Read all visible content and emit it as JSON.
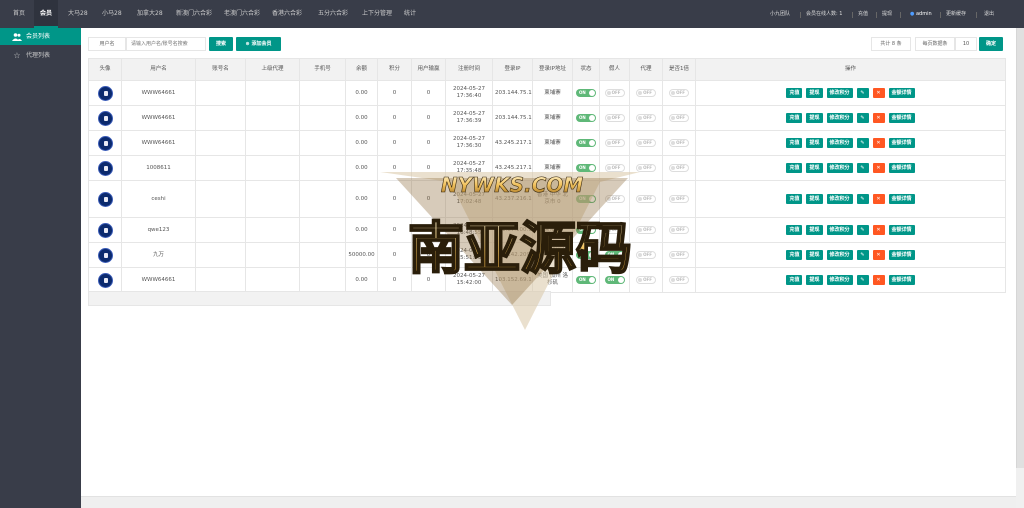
{
  "topnav": {
    "items": [
      "首页",
      "会员",
      "大马28",
      "小马28",
      "加拿大28",
      "新澳门六合彩",
      "老澳门六合彩",
      "香港六合彩",
      "五分六合彩",
      "上下分管理",
      "统计"
    ],
    "active": "会员",
    "right": {
      "promo": "小九团队",
      "online": "会员在线人数: 1",
      "recharge": "充值",
      "withdraw": "提现",
      "user": "admin",
      "password": "更新缓存",
      "logout": "退出"
    }
  },
  "sidebar": {
    "items": [
      {
        "label": "会员列表",
        "icon": "users-icon",
        "active": true
      },
      {
        "label": "代理列表",
        "icon": "star-icon",
        "active": false
      }
    ]
  },
  "toolbar": {
    "username_label": "用户名",
    "search_placeholder": "请输入用户名/账号名搜索",
    "search_button": "搜索",
    "add_button": "添加会员",
    "total_text": "共计 8 条",
    "per_page_label": "每页数据条",
    "per_page_value": "10",
    "confirm_button": "确定"
  },
  "table": {
    "columns": [
      "头像",
      "用户名",
      "账号名",
      "上级代理",
      "手机号",
      "余额",
      "积分",
      "用户输赢",
      "注册时间",
      "登录IP",
      "登录IP地址",
      "状态",
      "假人",
      "代理",
      "是否1倍",
      "操作"
    ],
    "actions": [
      "充值",
      "提现",
      "修改积分",
      "修改",
      "删除",
      "金额详情"
    ],
    "rows": [
      {
        "username": "WWW64661",
        "balance": "0.00",
        "points": "0",
        "winloss": "0",
        "reg_date": "2024-05-27",
        "reg_time": "17:36:40",
        "ip": "203.144.75.189",
        "location": "柬埔寨",
        "status": "ON",
        "fake": "OFF",
        "agent": "OFF",
        "single": "OFF"
      },
      {
        "username": "WWW64661",
        "balance": "0.00",
        "points": "0",
        "winloss": "0",
        "reg_date": "2024-05-27",
        "reg_time": "17:36:39",
        "ip": "203.144.75.189",
        "location": "柬埔寨",
        "status": "ON",
        "fake": "OFF",
        "agent": "OFF",
        "single": "OFF"
      },
      {
        "username": "WWW64661",
        "balance": "0.00",
        "points": "0",
        "winloss": "0",
        "reg_date": "2024-05-27",
        "reg_time": "17:36:30",
        "ip": "43.245.217.174",
        "location": "柬埔寨",
        "status": "ON",
        "fake": "OFF",
        "agent": "OFF",
        "single": "OFF"
      },
      {
        "username": "1008611",
        "balance": "0.00",
        "points": "0",
        "winloss": "0",
        "reg_date": "2024-05-27",
        "reg_time": "17:35:48",
        "ip": "43.245.217.174",
        "location": "柬埔寨",
        "status": "ON",
        "fake": "OFF",
        "agent": "OFF",
        "single": "OFF"
      },
      {
        "username": "ceshi",
        "balance": "0.00",
        "points": "0",
        "winloss": "0",
        "reg_date": "2024-05-27",
        "reg_time": "17:02:48",
        "ip": "43.237.216.127",
        "location": "香港 中华 北京市 0",
        "status": "ON",
        "fake": "OFF",
        "agent": "OFF",
        "single": "OFF"
      },
      {
        "username": "qwe123",
        "balance": "0.00",
        "points": "0",
        "winloss": "0",
        "reg_date": "2024-05-27",
        "reg_time": "16:48:55",
        "ip": "111.67.100.114",
        "location": "柬埔寨",
        "status": "ON",
        "fake": "OFF",
        "agent": "OFF",
        "single": "OFF"
      },
      {
        "username": "九万",
        "balance": "50000.00",
        "points": "0",
        "winloss": "0",
        "reg_date": "2024-05-27",
        "reg_time": "15:51:53",
        "ip": "103.142.209.3",
        "location": "美国 加州 洛杉矶",
        "status": "ON",
        "fake": "ON",
        "agent": "OFF",
        "single": "OFF"
      },
      {
        "username": "WWW64661",
        "balance": "0.00",
        "points": "0",
        "winloss": "0",
        "reg_date": "2024-05-27",
        "reg_time": "15:42:00",
        "ip": "103.152.69.17",
        "location": "美国 加州 洛杉矶",
        "status": "ON",
        "fake": "ON",
        "agent": "OFF",
        "single": "OFF"
      }
    ]
  },
  "watermark": {
    "url": "NYWKS.COM",
    "text": "南亚源码"
  },
  "colors": {
    "primary": "#009688",
    "orange": "#ff5722",
    "nav": "#393d49",
    "toggle_on": "#5fb878"
  }
}
